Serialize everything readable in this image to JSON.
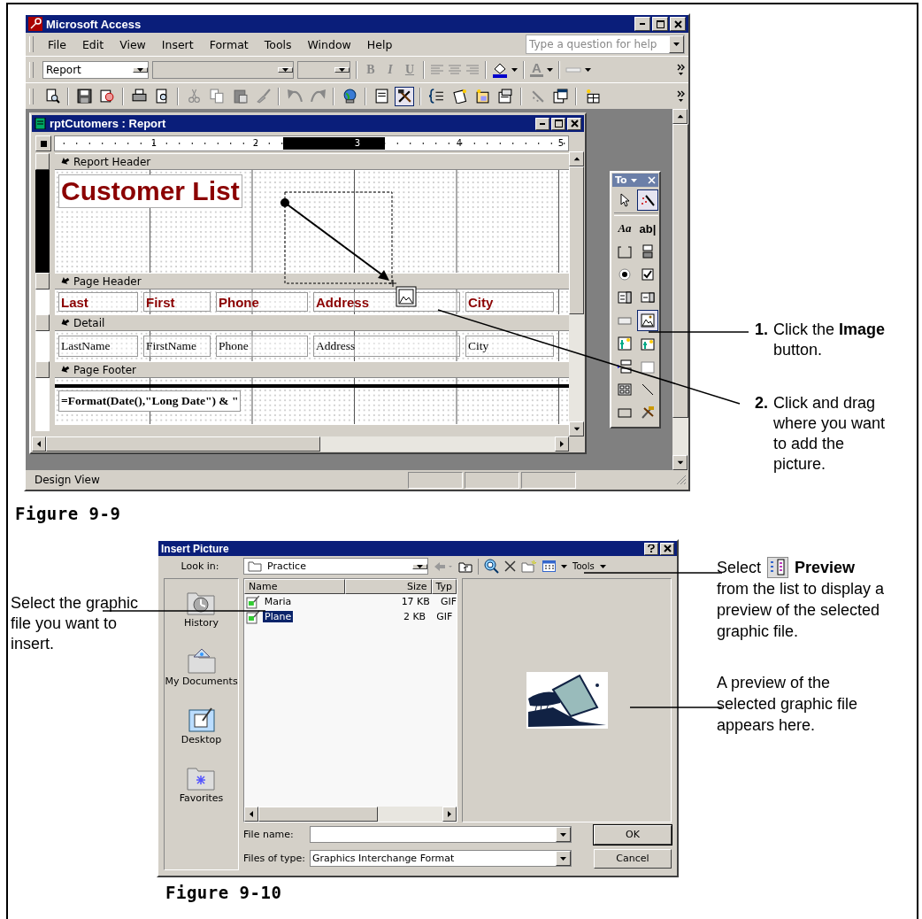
{
  "figure_1": {
    "window": {
      "title": "Microsoft Access"
    },
    "menu": [
      {
        "label": "File"
      },
      {
        "label": "Edit"
      },
      {
        "label": "View"
      },
      {
        "label": "Insert"
      },
      {
        "label": "Format"
      },
      {
        "label": "Tools"
      },
      {
        "label": "Window"
      },
      {
        "label": "Help"
      }
    ],
    "help_box": {
      "placeholder": "Type a question for help"
    },
    "formatting_toolbar": {
      "object_box": "Report",
      "format_buttons": [
        {
          "glyph": "B",
          "kind": "bold"
        },
        {
          "glyph": "I",
          "kind": "italic"
        },
        {
          "glyph": "U",
          "kind": "underline"
        }
      ],
      "font_color_glyph": "A",
      "disabled": true
    },
    "design_toolbar": [
      {
        "kind": "view",
        "selected": false
      },
      {
        "kind": "save",
        "selected": false
      },
      {
        "kind": "search",
        "selected": false
      },
      {
        "kind": "print",
        "selected": false
      },
      {
        "kind": "preview",
        "selected": false
      },
      {
        "kind": "cut",
        "selected": false
      },
      {
        "kind": "copy",
        "selected": false
      },
      {
        "kind": "paste",
        "selected": false
      },
      {
        "kind": "brush",
        "selected": false
      },
      {
        "kind": "undo",
        "selected": false
      },
      {
        "kind": "redo",
        "selected": false
      },
      {
        "kind": "globe",
        "selected": false
      },
      {
        "kind": "list",
        "selected": false
      },
      {
        "kind": "tools",
        "selected": true
      },
      {
        "kind": "sorting",
        "selected": false
      },
      {
        "kind": "autoformat",
        "selected": false
      },
      {
        "kind": "code",
        "selected": false
      },
      {
        "kind": "properties",
        "selected": false
      },
      {
        "kind": "build",
        "selected": false
      },
      {
        "kind": "database",
        "selected": false
      },
      {
        "kind": "new",
        "selected": false
      }
    ],
    "report_window": {
      "title": "rptCutomers : Report",
      "ruler": [
        "1",
        "2",
        "3",
        "4",
        "5"
      ],
      "sections": [
        {
          "title": "Report Header",
          "kind": "report-header",
          "controls": [
            {
              "kind": "title",
              "text": "Customer List"
            }
          ]
        },
        {
          "title": "Page Header",
          "kind": "page-header",
          "controls": [
            {
              "kind": "label",
              "text": "Last"
            },
            {
              "kind": "label",
              "text": "First"
            },
            {
              "kind": "label",
              "text": "Phone"
            },
            {
              "kind": "label",
              "text": "Address"
            },
            {
              "kind": "label",
              "text": "City"
            }
          ]
        },
        {
          "title": "Detail",
          "kind": "detail",
          "controls": [
            {
              "kind": "textbox",
              "text": "LastName"
            },
            {
              "kind": "textbox",
              "text": "FirstName"
            },
            {
              "kind": "textbox",
              "text": "Phone"
            },
            {
              "kind": "textbox",
              "text": "Address"
            },
            {
              "kind": "textbox",
              "text": "City"
            }
          ]
        },
        {
          "title": "Page Footer",
          "kind": "page-footer",
          "controls": [
            {
              "kind": "expression",
              "text": "=Format(Date(),\"Long Date\") & \""
            }
          ]
        }
      ]
    },
    "toolbox": {
      "title": "To",
      "tools": [
        {
          "kind": "pointer",
          "selected": false
        },
        {
          "kind": "wizard",
          "selected": true
        },
        {
          "kind": "label",
          "glyph": "Aa",
          "selected": false
        },
        {
          "kind": "textbox",
          "glyph": "ab|",
          "selected": false
        },
        {
          "kind": "group",
          "selected": false
        },
        {
          "kind": "toggle",
          "selected": false
        },
        {
          "kind": "option",
          "selected": false
        },
        {
          "kind": "check",
          "selected": false
        },
        {
          "kind": "combo",
          "selected": false
        },
        {
          "kind": "listbox",
          "selected": false
        },
        {
          "kind": "command",
          "selected": false
        },
        {
          "kind": "image",
          "selected": true
        },
        {
          "kind": "frame",
          "selected": false
        },
        {
          "kind": "bound-frame",
          "selected": false
        },
        {
          "kind": "page-break",
          "selected": false
        },
        {
          "kind": "tab",
          "selected": false
        },
        {
          "kind": "subform",
          "selected": false
        },
        {
          "kind": "line",
          "selected": false
        },
        {
          "kind": "rectangle",
          "selected": false
        },
        {
          "kind": "more",
          "selected": false
        }
      ]
    },
    "status_bar": "Design View"
  },
  "figure_1_caption": "Figure 9-9",
  "figure_1_callouts": [
    {
      "number": "1.",
      "text": "Click the **Image** button."
    },
    {
      "number": "2.",
      "text": "Click and drag where you want to add the picture."
    }
  ],
  "figure_2": {
    "title": "Insert Picture",
    "look_in_label": "Look in:",
    "look_in_value": "Practice",
    "tools_label": "Tools",
    "places": [
      {
        "kind": "history",
        "label": "History"
      },
      {
        "kind": "documents",
        "label": "My Documents"
      },
      {
        "kind": "desktop",
        "label": "Desktop"
      },
      {
        "kind": "favorites",
        "label": "Favorites"
      }
    ],
    "columns": [
      "Name",
      "Size",
      "Typ"
    ],
    "files": [
      {
        "name": "Maria",
        "size": "17 KB",
        "type": "GIF",
        "selected": false
      },
      {
        "name": "Plane",
        "size": "2 KB",
        "type": "GIF",
        "selected": true
      }
    ],
    "file_name_label": "File name:",
    "files_of_type_label": "Files of type:",
    "files_of_type_value": "Graphics Interchange Format",
    "buttons": [
      "OK",
      "Cancel"
    ]
  },
  "figure_2_caption": "Figure 9-10",
  "figure_2_callouts": {
    "left": "Select the graphic file you want to insert.",
    "views_before": "Select",
    "views_label": "Preview",
    "views_after": "from the list to display a preview of the selected graphic file.",
    "preview": "A preview of the selected graphic file appears here."
  }
}
